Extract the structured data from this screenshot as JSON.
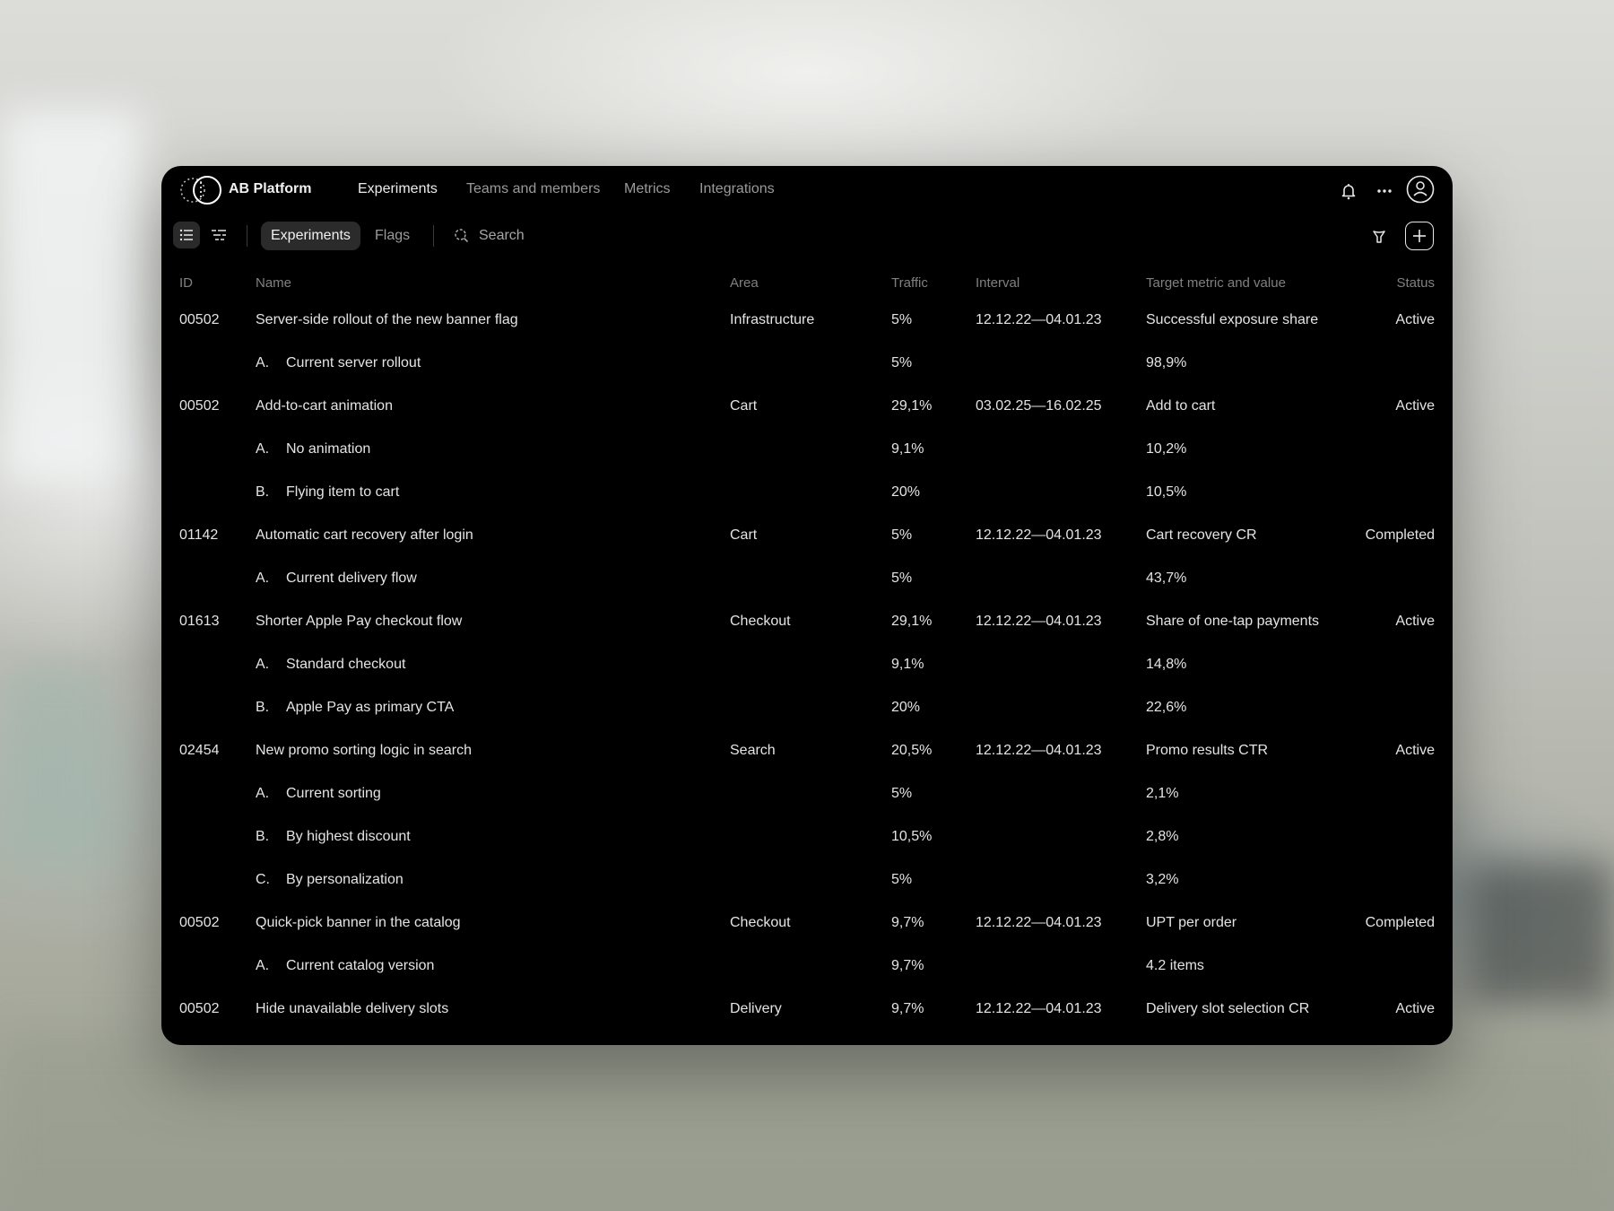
{
  "app": {
    "brand": "AB Platform",
    "nav": [
      "Experiments",
      "Teams and members",
      "Metrics",
      "Integrations"
    ]
  },
  "toolbar": {
    "tabs": [
      "Experiments",
      "Flags"
    ],
    "search_placeholder": "Search"
  },
  "table": {
    "columns": {
      "id": "ID",
      "name": "Name",
      "area": "Area",
      "traffic": "Traffic",
      "interval": "Interval",
      "target": "Target metric and value",
      "status": "Status"
    },
    "experiments": [
      {
        "id": "00502",
        "name": "Server-side rollout of the new banner flag",
        "area": "Infrastructure",
        "traffic": "5%",
        "interval": "12.12.22—04.01.23",
        "target": "Successful exposure share",
        "status": "Active",
        "variants": [
          {
            "letter": "A.",
            "name": "Current server rollout",
            "traffic": "5%",
            "value": "98,9%"
          }
        ]
      },
      {
        "id": "00502",
        "name": "Add-to-cart animation",
        "area": "Cart",
        "traffic": "29,1%",
        "interval": "03.02.25—16.02.25",
        "target": "Add to cart",
        "status": "Active",
        "variants": [
          {
            "letter": "A.",
            "name": "No animation",
            "traffic": "9,1%",
            "value": "10,2%"
          },
          {
            "letter": "B.",
            "name": "Flying item to cart",
            "traffic": "20%",
            "value": "10,5%"
          }
        ]
      },
      {
        "id": "01142",
        "name": "Automatic cart recovery after login",
        "area": "Cart",
        "traffic": "5%",
        "interval": "12.12.22—04.01.23",
        "target": "Cart recovery CR",
        "status": "Completed",
        "variants": [
          {
            "letter": "A.",
            "name": "Current delivery flow",
            "traffic": "5%",
            "value": "43,7%"
          }
        ]
      },
      {
        "id": "01613",
        "name": "Shorter Apple Pay checkout flow",
        "area": "Checkout",
        "traffic": "29,1%",
        "interval": "12.12.22—04.01.23",
        "target": "Share of one-tap payments",
        "status": "Active",
        "variants": [
          {
            "letter": "A.",
            "name": "Standard checkout",
            "traffic": "9,1%",
            "value": "14,8%"
          },
          {
            "letter": "B.",
            "name": "Apple Pay as primary CTA",
            "traffic": "20%",
            "value": "22,6%"
          }
        ]
      },
      {
        "id": "02454",
        "name": "New promo sorting logic in search",
        "area": "Search",
        "traffic": "20,5%",
        "interval": "12.12.22—04.01.23",
        "target": "Promo results CTR",
        "status": "Active",
        "variants": [
          {
            "letter": "A.",
            "name": "Current sorting",
            "traffic": "5%",
            "value": "2,1%"
          },
          {
            "letter": "B.",
            "name": "By highest discount",
            "traffic": "10,5%",
            "value": "2,8%"
          },
          {
            "letter": "C.",
            "name": "By personalization",
            "traffic": "5%",
            "value": "3,2%"
          }
        ]
      },
      {
        "id": "00502",
        "name": "Quick-pick banner in the catalog",
        "area": "Checkout",
        "traffic": "9,7%",
        "interval": "12.12.22—04.01.23",
        "target": "UPT per order",
        "status": "Completed",
        "variants": [
          {
            "letter": "A.",
            "name": "Current catalog version",
            "traffic": "9,7%",
            "value": "4.2 items"
          }
        ]
      },
      {
        "id": "00502",
        "name": "Hide unavailable delivery slots",
        "area": "Delivery",
        "traffic": "9,7%",
        "interval": "12.12.22—04.01.23",
        "target": "Delivery slot selection CR",
        "status": "Active",
        "variants": []
      }
    ]
  }
}
